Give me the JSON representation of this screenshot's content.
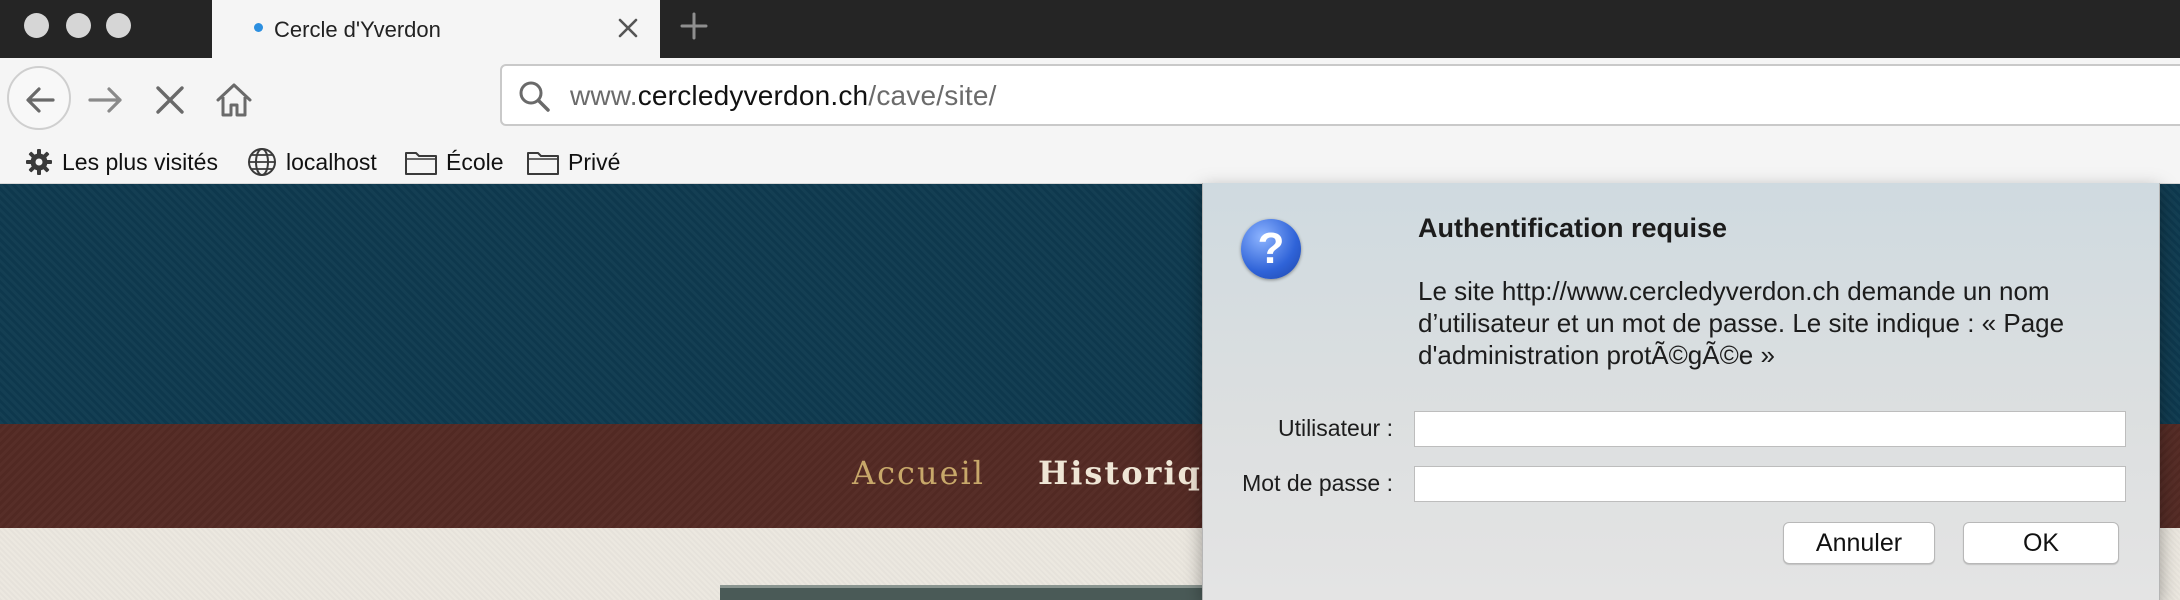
{
  "tab": {
    "title": "Cercle d'Yverdon"
  },
  "url": {
    "domain_prefix": "www.",
    "domain": "cercledyverdon.ch",
    "path": "/cave/site/"
  },
  "bookmarks": [
    {
      "label": "Les plus visités",
      "icon": "gear-icon"
    },
    {
      "label": "localhost",
      "icon": "globe-icon"
    },
    {
      "label": "École",
      "icon": "folder-icon"
    },
    {
      "label": "Privé",
      "icon": "folder-icon"
    }
  ],
  "site_menu": {
    "items": [
      "Accueil",
      "Historiqu"
    ]
  },
  "dialog": {
    "icon_glyph": "?",
    "title": "Authentification requise",
    "message": "Le site http://www.cercledyverdon.ch demande un nom d’utilisateur et un mot de passe. Le site indique : « Page d'administration protÃ©gÃ©e »",
    "user_label": "Utilisateur :",
    "user_value": "",
    "password_label": "Mot de passe :",
    "password_value": "",
    "cancel_label": "Annuler",
    "ok_label": "OK"
  },
  "colors": {
    "tabstrip": "#252525",
    "banner": "#0e3a4f",
    "menubar": "#542a24",
    "menu_active": "#c8a86a",
    "tab_indicator": "#2c8fe0"
  }
}
